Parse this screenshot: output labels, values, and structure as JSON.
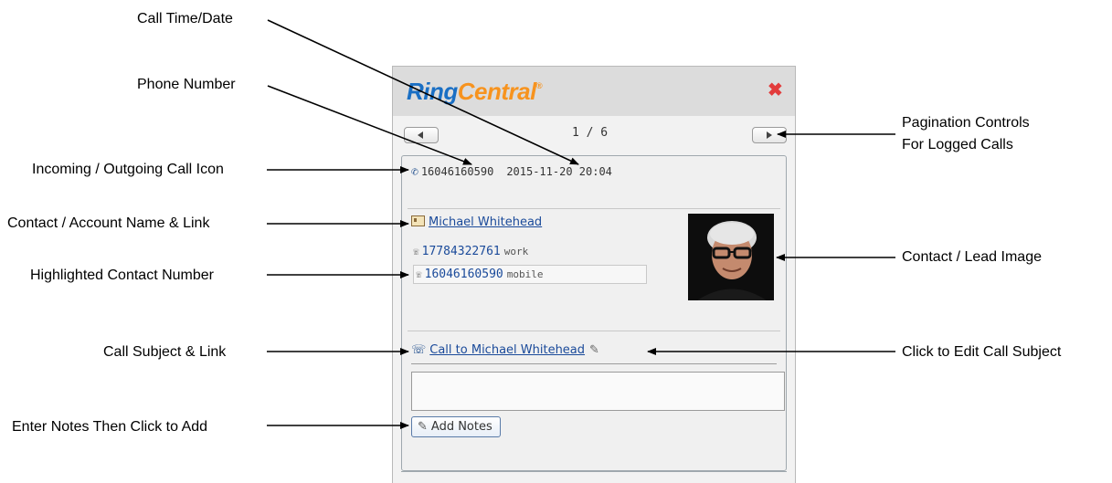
{
  "annotations": {
    "call_time_date": "Call Time/Date",
    "phone_number": "Phone Number",
    "pagination_line1": "Pagination Controls",
    "pagination_line2": "For Logged Calls",
    "call_icon": "Incoming / Outgoing Call Icon",
    "contact_name_link": "Contact / Account Name & Link",
    "contact_image": "Contact / Lead Image",
    "highlighted_number": "Highlighted Contact Number",
    "call_subject_link": "Call Subject & Link",
    "edit_call_subject": "Click to Edit Call Subject",
    "enter_notes": "Enter Notes Then Click to Add"
  },
  "widget": {
    "logo_ring": "Ring",
    "logo_central": "Central",
    "logo_reg": "®",
    "close_icon": "✖",
    "pagination": {
      "indicator": "1 / 6",
      "prev_icon": "chevron-left-icon",
      "next_icon": "chevron-right-icon"
    },
    "call": {
      "direction_icon": "outgoing-call-icon",
      "phone_number": "16046160590",
      "date_time": "2015-11-20 20:04"
    },
    "contact": {
      "name": "Michael Whitehead",
      "numbers": [
        {
          "number": "17784322761",
          "type": "work",
          "highlighted": false
        },
        {
          "number": "16046160590",
          "type": "mobile",
          "highlighted": true
        }
      ]
    },
    "subject": {
      "text": "Call to Michael Whitehead"
    },
    "notes": {
      "value": "",
      "button_label": "Add Notes"
    }
  },
  "colors": {
    "brand_blue": "#1a6fc4",
    "brand_orange": "#f7931e",
    "close_red": "#e23b3b",
    "link_blue": "#1a4a9a"
  }
}
